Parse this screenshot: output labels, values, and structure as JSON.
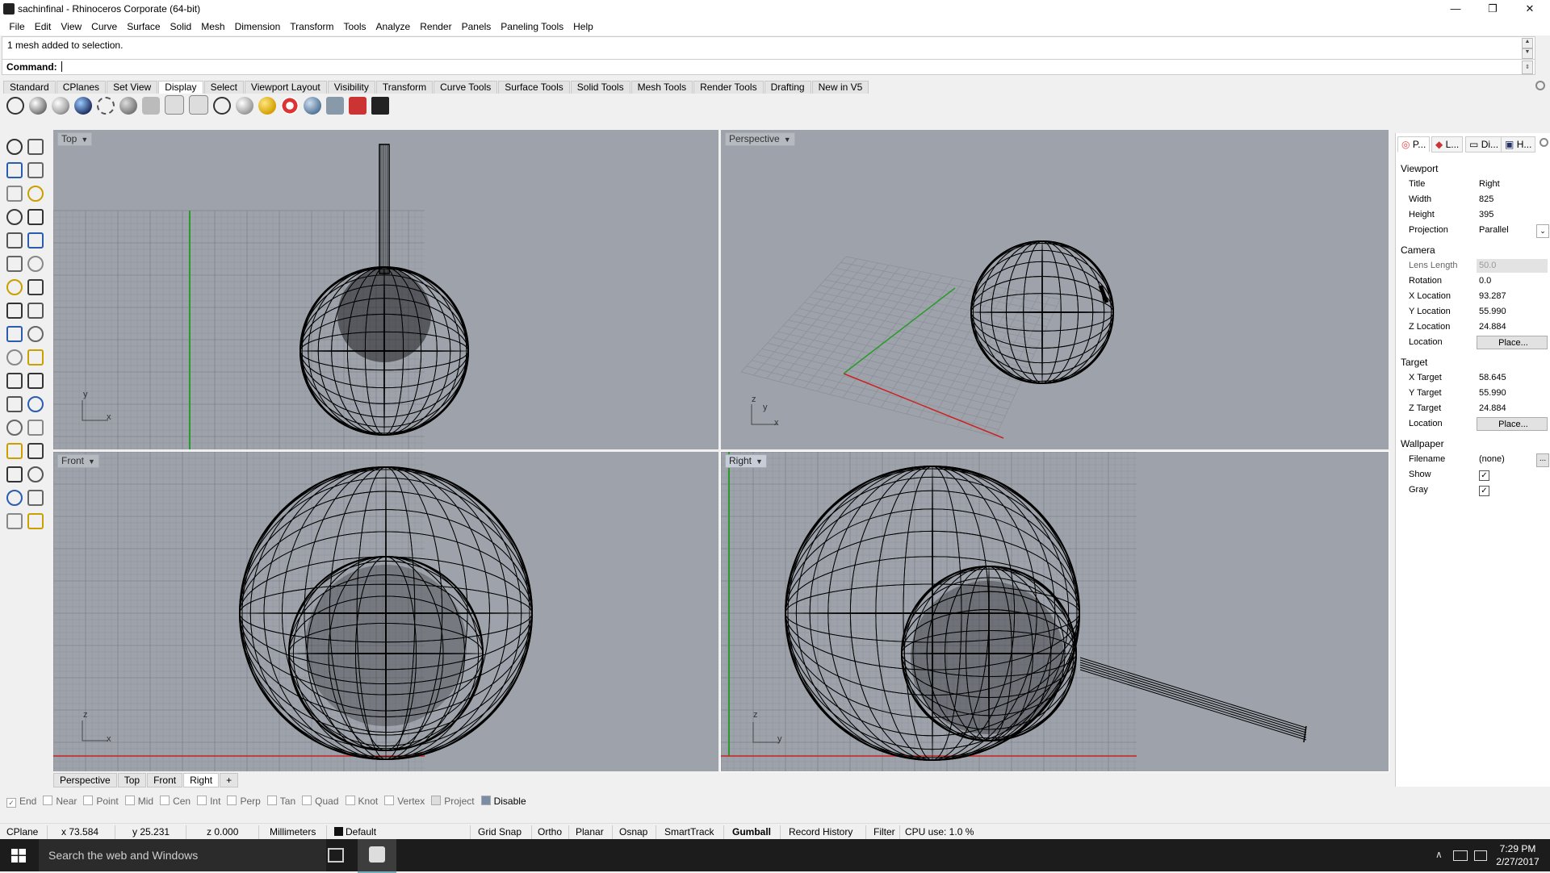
{
  "window": {
    "title": "sachinfinal - Rhinoceros Corporate (64-bit)",
    "minimize": "—",
    "maximize": "❐",
    "close": "✕"
  },
  "menu": [
    "File",
    "Edit",
    "View",
    "Curve",
    "Surface",
    "Solid",
    "Mesh",
    "Dimension",
    "Transform",
    "Tools",
    "Analyze",
    "Render",
    "Panels",
    "Paneling Tools",
    "Help"
  ],
  "command": {
    "history": "1 mesh added to selection.",
    "prompt_label": "Command:",
    "value": ""
  },
  "toolbar_tabs": [
    "Standard",
    "CPlanes",
    "Set View",
    "Display",
    "Select",
    "Viewport Layout",
    "Visibility",
    "Transform",
    "Curve Tools",
    "Surface Tools",
    "Solid Tools",
    "Mesh Tools",
    "Render Tools",
    "Drafting",
    "New in V5"
  ],
  "toolbar_active_tab": "Display",
  "viewports": {
    "top": {
      "label": "Top",
      "axis_a": "y",
      "axis_b": "x"
    },
    "perspective": {
      "label": "Perspective",
      "axis_a": "z",
      "axis_b": "y",
      "axis_c": "x"
    },
    "front": {
      "label": "Front",
      "axis_a": "z",
      "axis_b": "x"
    },
    "right": {
      "label": "Right",
      "axis_a": "z",
      "axis_b": "y"
    }
  },
  "viewport_tabs": [
    "Perspective",
    "Top",
    "Front",
    "Right"
  ],
  "viewport_tab_add": "+",
  "osnaps": [
    {
      "label": "End",
      "checked": true
    },
    {
      "label": "Near",
      "checked": false
    },
    {
      "label": "Point",
      "checked": false
    },
    {
      "label": "Mid",
      "checked": false
    },
    {
      "label": "Cen",
      "checked": false
    },
    {
      "label": "Int",
      "checked": false
    },
    {
      "label": "Perp",
      "checked": false
    },
    {
      "label": "Tan",
      "checked": false
    },
    {
      "label": "Quad",
      "checked": false
    },
    {
      "label": "Knot",
      "checked": false
    },
    {
      "label": "Vertex",
      "checked": false
    },
    {
      "label": "Project",
      "checked": false
    },
    {
      "label": "Disable",
      "checked": false
    }
  ],
  "status": {
    "cplane": "CPlane",
    "x": "x 73.584",
    "y": "y 25.231",
    "z": "z 0.000",
    "units": "Millimeters",
    "layer": "Default",
    "grid_snap": "Grid Snap",
    "ortho": "Ortho",
    "planar": "Planar",
    "osnap": "Osnap",
    "smarttrack": "SmartTrack",
    "gumball": "Gumball",
    "record_history": "Record History",
    "filter": "Filter",
    "cpu": "CPU use: 1.0 %"
  },
  "panel": {
    "tabs": [
      "P...",
      "L...",
      "Di...",
      "H..."
    ],
    "viewport_header": "Viewport",
    "title_k": "Title",
    "title_v": "Right",
    "width_k": "Width",
    "width_v": "825",
    "height_k": "Height",
    "height_v": "395",
    "projection_k": "Projection",
    "projection_v": "Parallel",
    "camera_header": "Camera",
    "lens_k": "Lens Length",
    "lens_v": "50.0",
    "rotation_k": "Rotation",
    "rotation_v": "0.0",
    "xloc_k": "X Location",
    "xloc_v": "93.287",
    "yloc_k": "Y Location",
    "yloc_v": "55.990",
    "zloc_k": "Z Location",
    "zloc_v": "24.884",
    "camloc_k": "Location",
    "camloc_btn": "Place...",
    "target_header": "Target",
    "xt_k": "X Target",
    "xt_v": "58.645",
    "yt_k": "Y Target",
    "yt_v": "55.990",
    "zt_k": "Z Target",
    "zt_v": "24.884",
    "tloc_k": "Location",
    "tloc_btn": "Place...",
    "wallpaper_header": "Wallpaper",
    "filename_k": "Filename",
    "filename_v": "(none)",
    "filename_btn": "...",
    "show_k": "Show",
    "gray_k": "Gray"
  },
  "taskbar": {
    "search_placeholder": "Search the web and Windows",
    "time": "7:29 PM",
    "date": "2/27/2017"
  }
}
